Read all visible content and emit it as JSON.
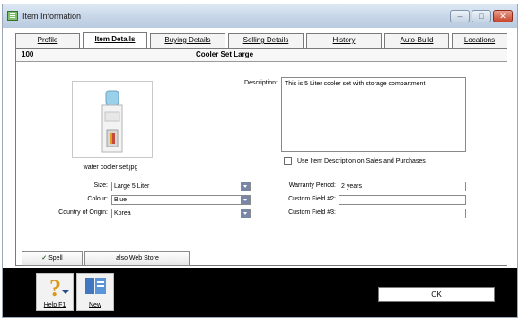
{
  "window": {
    "title": "Item Information"
  },
  "tabs": [
    {
      "label": "Profile"
    },
    {
      "label": "Item Details"
    },
    {
      "label": "Buying Details"
    },
    {
      "label": "Selling Details"
    },
    {
      "label": "History"
    },
    {
      "label": "Auto-Build"
    },
    {
      "label": "Locations"
    }
  ],
  "item": {
    "code": "100",
    "name": "Cooler Set Large"
  },
  "image": {
    "caption": "water cooler set.jpg"
  },
  "description": {
    "label": "Description:",
    "value": "This is 5 Liter cooler set with storage compartment",
    "use_checkbox_label": "Use Item Description on Sales and Purchases"
  },
  "fields_left": [
    {
      "label": "Size:",
      "value": "Large 5 Liter"
    },
    {
      "label": "Colour:",
      "value": "Blue"
    },
    {
      "label": "Country of Origin:",
      "value": "Korea"
    }
  ],
  "fields_right": [
    {
      "label": "Warranty Period:",
      "value": "2 years"
    },
    {
      "label": "Custom Field #2:",
      "value": ""
    },
    {
      "label": "Custom Field #3:",
      "value": ""
    }
  ],
  "buttons": {
    "spell": "Spell",
    "web_store": "also Web Store",
    "help": "Help F1",
    "new": "New",
    "ok": "OK"
  },
  "colors": {
    "titlebar": "#c8d7e8",
    "footer": "#000000",
    "dropdown": "#7a86a8"
  }
}
